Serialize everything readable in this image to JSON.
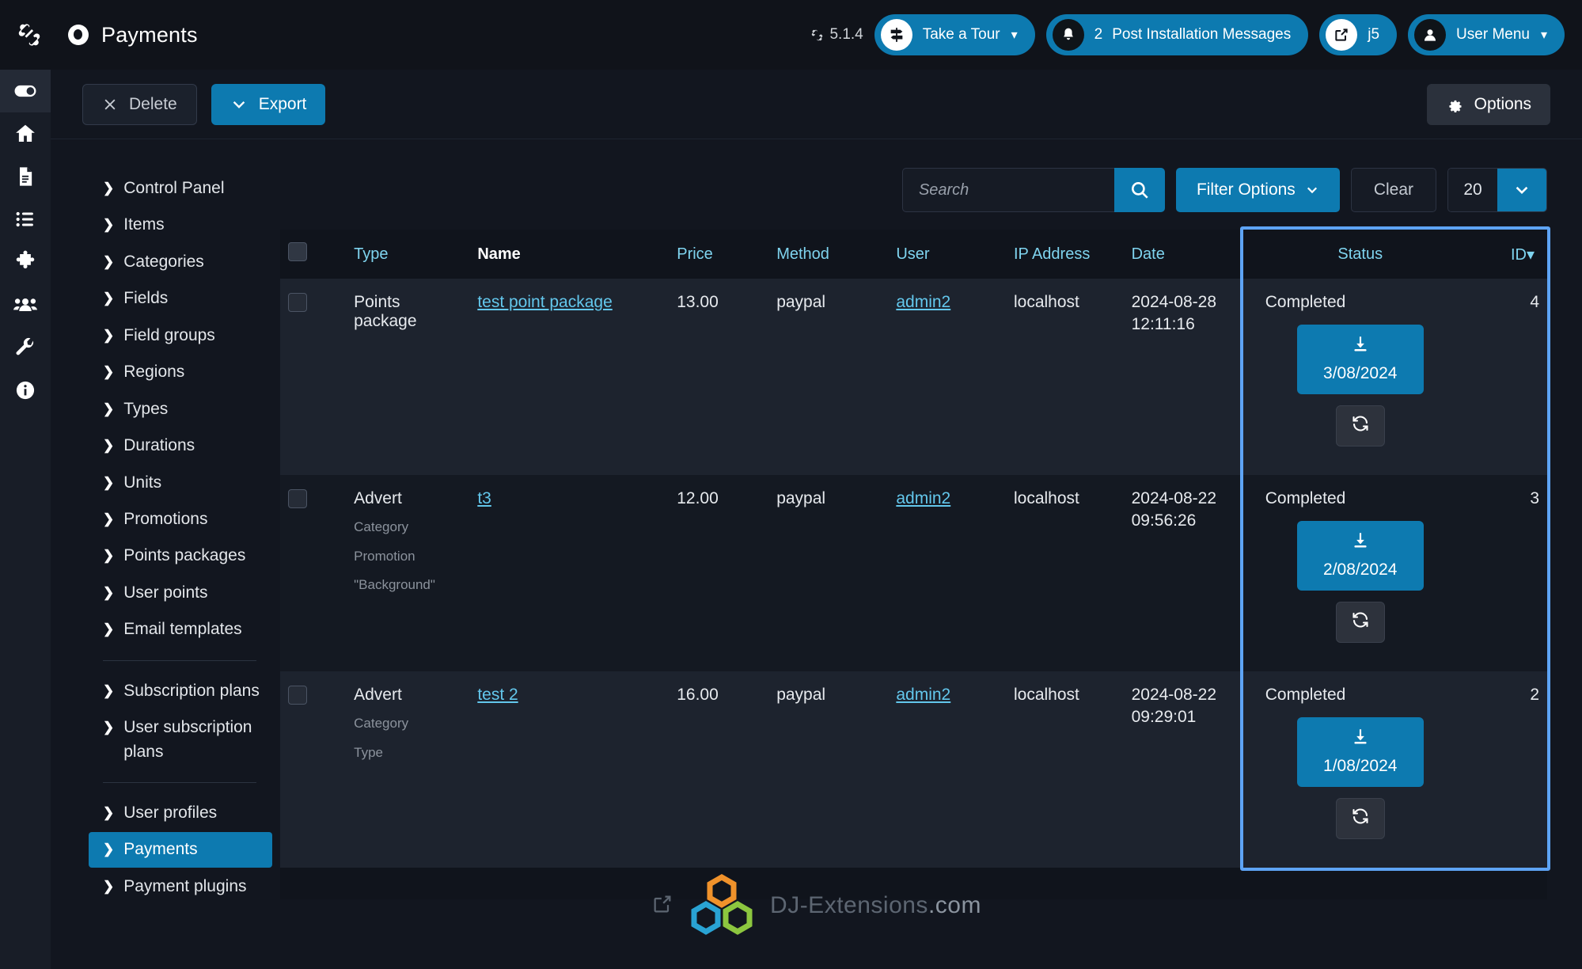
{
  "header": {
    "joomla_icon": "joomla-logo-icon",
    "brand_icon": "circle-dot-icon",
    "title": "Payments",
    "version_icon": "joomla-mini-icon",
    "version": "5.1.4",
    "take_a_tour": {
      "label": "Take a Tour",
      "icon": "signpost-icon",
      "chevron": "chevron-down-icon"
    },
    "post_installation": {
      "count": "2",
      "label": "Post Installation Messages",
      "icon": "bell-icon"
    },
    "site_link": {
      "label": "j5",
      "icon": "external-link-icon"
    },
    "user_menu": {
      "label": "User Menu",
      "icon": "user-circle-icon",
      "chevron": "chevron-down-icon"
    }
  },
  "rail": {
    "items": [
      {
        "icon": "toggle-icon",
        "name": "toggle-sidebar",
        "active": true
      },
      {
        "icon": "home-icon",
        "name": "home"
      },
      {
        "icon": "document-icon",
        "name": "content"
      },
      {
        "icon": "list-icon",
        "name": "menus"
      },
      {
        "icon": "puzzle-icon",
        "name": "components"
      },
      {
        "icon": "users-icon",
        "name": "users"
      },
      {
        "icon": "wrench-icon",
        "name": "system"
      },
      {
        "icon": "info-icon",
        "name": "help"
      }
    ]
  },
  "toolbar": {
    "delete_label": "Delete",
    "delete_icon": "close-icon",
    "export_label": "Export",
    "export_icon": "chevron-down-icon",
    "options_label": "Options",
    "options_icon": "gear-icon"
  },
  "sidebar": {
    "items": [
      {
        "label": "Control Panel"
      },
      {
        "label": "Items"
      },
      {
        "label": "Categories"
      },
      {
        "label": "Fields"
      },
      {
        "label": "Field groups"
      },
      {
        "label": "Regions"
      },
      {
        "label": "Types"
      },
      {
        "label": "Durations"
      },
      {
        "label": "Units"
      },
      {
        "label": "Promotions"
      },
      {
        "label": "Points packages"
      },
      {
        "label": "User points"
      },
      {
        "label": "Email templates"
      },
      {
        "separator": true
      },
      {
        "label": "Subscription plans"
      },
      {
        "label": "User subscription plans"
      },
      {
        "separator": true
      },
      {
        "label": "User profiles"
      },
      {
        "label": "Payments",
        "active": true
      },
      {
        "label": "Payment plugins"
      }
    ]
  },
  "search": {
    "placeholder": "Search",
    "value": "",
    "search_icon": "search-icon",
    "filter_label": "Filter Options",
    "filter_chevron": "chevron-down-icon",
    "clear_label": "Clear",
    "limit_value": "20",
    "limit_chevron": "chevron-down-icon"
  },
  "table": {
    "columns": [
      {
        "key": "check",
        "label": ""
      },
      {
        "key": "type",
        "label": "Type"
      },
      {
        "key": "name",
        "label": "Name",
        "sorted": true
      },
      {
        "key": "price",
        "label": "Price"
      },
      {
        "key": "method",
        "label": "Method"
      },
      {
        "key": "user",
        "label": "User"
      },
      {
        "key": "ip",
        "label": "IP Address"
      },
      {
        "key": "date",
        "label": "Date"
      },
      {
        "key": "status",
        "label": "Status"
      },
      {
        "key": "id",
        "label": "ID",
        "sort_arrow": "caret-down-icon"
      }
    ],
    "rows": [
      {
        "type": "Points package",
        "sub": [],
        "name": "test point package",
        "price": "13.00",
        "method": "paypal",
        "user": "admin2",
        "ip": "localhost",
        "date_day": "2024-08-28",
        "date_time": "12:11:16",
        "status": "Completed",
        "download_label": "3/08/2024",
        "download_icon": "download-icon",
        "refresh_icon": "refresh-icon",
        "id": "4"
      },
      {
        "type": "Advert",
        "sub": [
          "Category",
          "Promotion",
          "\"Background\""
        ],
        "name": "t3",
        "price": "12.00",
        "method": "paypal",
        "user": "admin2",
        "ip": "localhost",
        "date_day": "2024-08-22",
        "date_time": "09:56:26",
        "status": "Completed",
        "download_label": "2/08/2024",
        "download_icon": "download-icon",
        "refresh_icon": "refresh-icon",
        "id": "3"
      },
      {
        "type": "Advert",
        "sub": [
          "Category",
          "Type"
        ],
        "name": "test 2",
        "price": "16.00",
        "method": "paypal",
        "user": "admin2",
        "ip": "localhost",
        "date_day": "2024-08-22",
        "date_time": "09:29:01",
        "status": "Completed",
        "download_label": "1/08/2024",
        "download_icon": "download-icon",
        "refresh_icon": "refresh-icon",
        "id": "2"
      }
    ]
  },
  "footer": {
    "external_icon": "external-link-icon",
    "logo_icon": "dj-extensions-hexagons-icon",
    "brand": "DJ-Extensions",
    "tld": ".com"
  },
  "colors": {
    "accent": "#0d7ab0",
    "link": "#63c7ec",
    "header_link": "#7fd4ef",
    "highlight": "#5ea4f5",
    "page_bg": "#12161f"
  }
}
